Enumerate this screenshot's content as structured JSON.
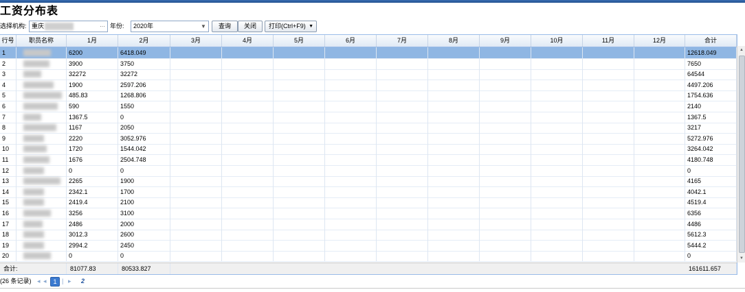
{
  "title": "工资分布表",
  "filter": {
    "org_label": "选择机构:",
    "org_value": "重庆",
    "org_trigger": "···",
    "year_label": "年份:",
    "year_value": "2020年",
    "query_btn": "查询",
    "close_btn": "关闭",
    "print_btn": "打印(Ctrl+F9)"
  },
  "columns": [
    "行号",
    "职员名称",
    "1月",
    "2月",
    "3月",
    "4月",
    "5月",
    "6月",
    "7月",
    "8月",
    "9月",
    "10月",
    "11月",
    "12月",
    "合计"
  ],
  "rows": [
    {
      "n": "1",
      "m1": "6200",
      "m2": "6418.049",
      "total": "12618.049"
    },
    {
      "n": "2",
      "m1": "3900",
      "m2": "3750",
      "total": "7650"
    },
    {
      "n": "3",
      "m1": "32272",
      "m2": "32272",
      "total": "64544"
    },
    {
      "n": "4",
      "m1": "1900",
      "m2": "2597.206",
      "total": "4497.206"
    },
    {
      "n": "5",
      "m1": "485.83",
      "m2": "1268.806",
      "total": "1754.636"
    },
    {
      "n": "6",
      "m1": "590",
      "m2": "1550",
      "total": "2140"
    },
    {
      "n": "7",
      "m1": "1367.5",
      "m2": "0",
      "total": "1367.5"
    },
    {
      "n": "8",
      "m1": "1167",
      "m2": "2050",
      "total": "3217"
    },
    {
      "n": "9",
      "m1": "2220",
      "m2": "3052.976",
      "total": "5272.976"
    },
    {
      "n": "10",
      "m1": "1720",
      "m2": "1544.042",
      "total": "3264.042"
    },
    {
      "n": "11",
      "m1": "1676",
      "m2": "2504.748",
      "total": "4180.748"
    },
    {
      "n": "12",
      "m1": "0",
      "m2": "0",
      "total": "0"
    },
    {
      "n": "13",
      "m1": "2265",
      "m2": "1900",
      "total": "4165"
    },
    {
      "n": "14",
      "m1": "2342.1",
      "m2": "1700",
      "total": "4042.1"
    },
    {
      "n": "15",
      "m1": "2419.4",
      "m2": "2100",
      "total": "4519.4"
    },
    {
      "n": "16",
      "m1": "3256",
      "m2": "3100",
      "total": "6356"
    },
    {
      "n": "17",
      "m1": "2486",
      "m2": "2000",
      "total": "4486"
    },
    {
      "n": "18",
      "m1": "3012.3",
      "m2": "2600",
      "total": "5612.3"
    },
    {
      "n": "19",
      "m1": "2994.2",
      "m2": "2450",
      "total": "5444.2"
    },
    {
      "n": "20",
      "m1": "0",
      "m2": "0",
      "total": "0"
    }
  ],
  "summary": {
    "label": "合计:",
    "m1": "81077.83",
    "m2": "80533.827",
    "total": "161611.657"
  },
  "pager": {
    "records": "(26 条记录)",
    "first": "◂",
    "prev": "◂",
    "current": "1",
    "next": "▸",
    "next_page": "2"
  },
  "colors": {
    "header_top": "#f9fbfd",
    "header_bottom": "#dfe9f5",
    "selected_row": "#8fb6e3",
    "grid_border": "#99bbe8",
    "page_current": "#3b7ad0"
  }
}
